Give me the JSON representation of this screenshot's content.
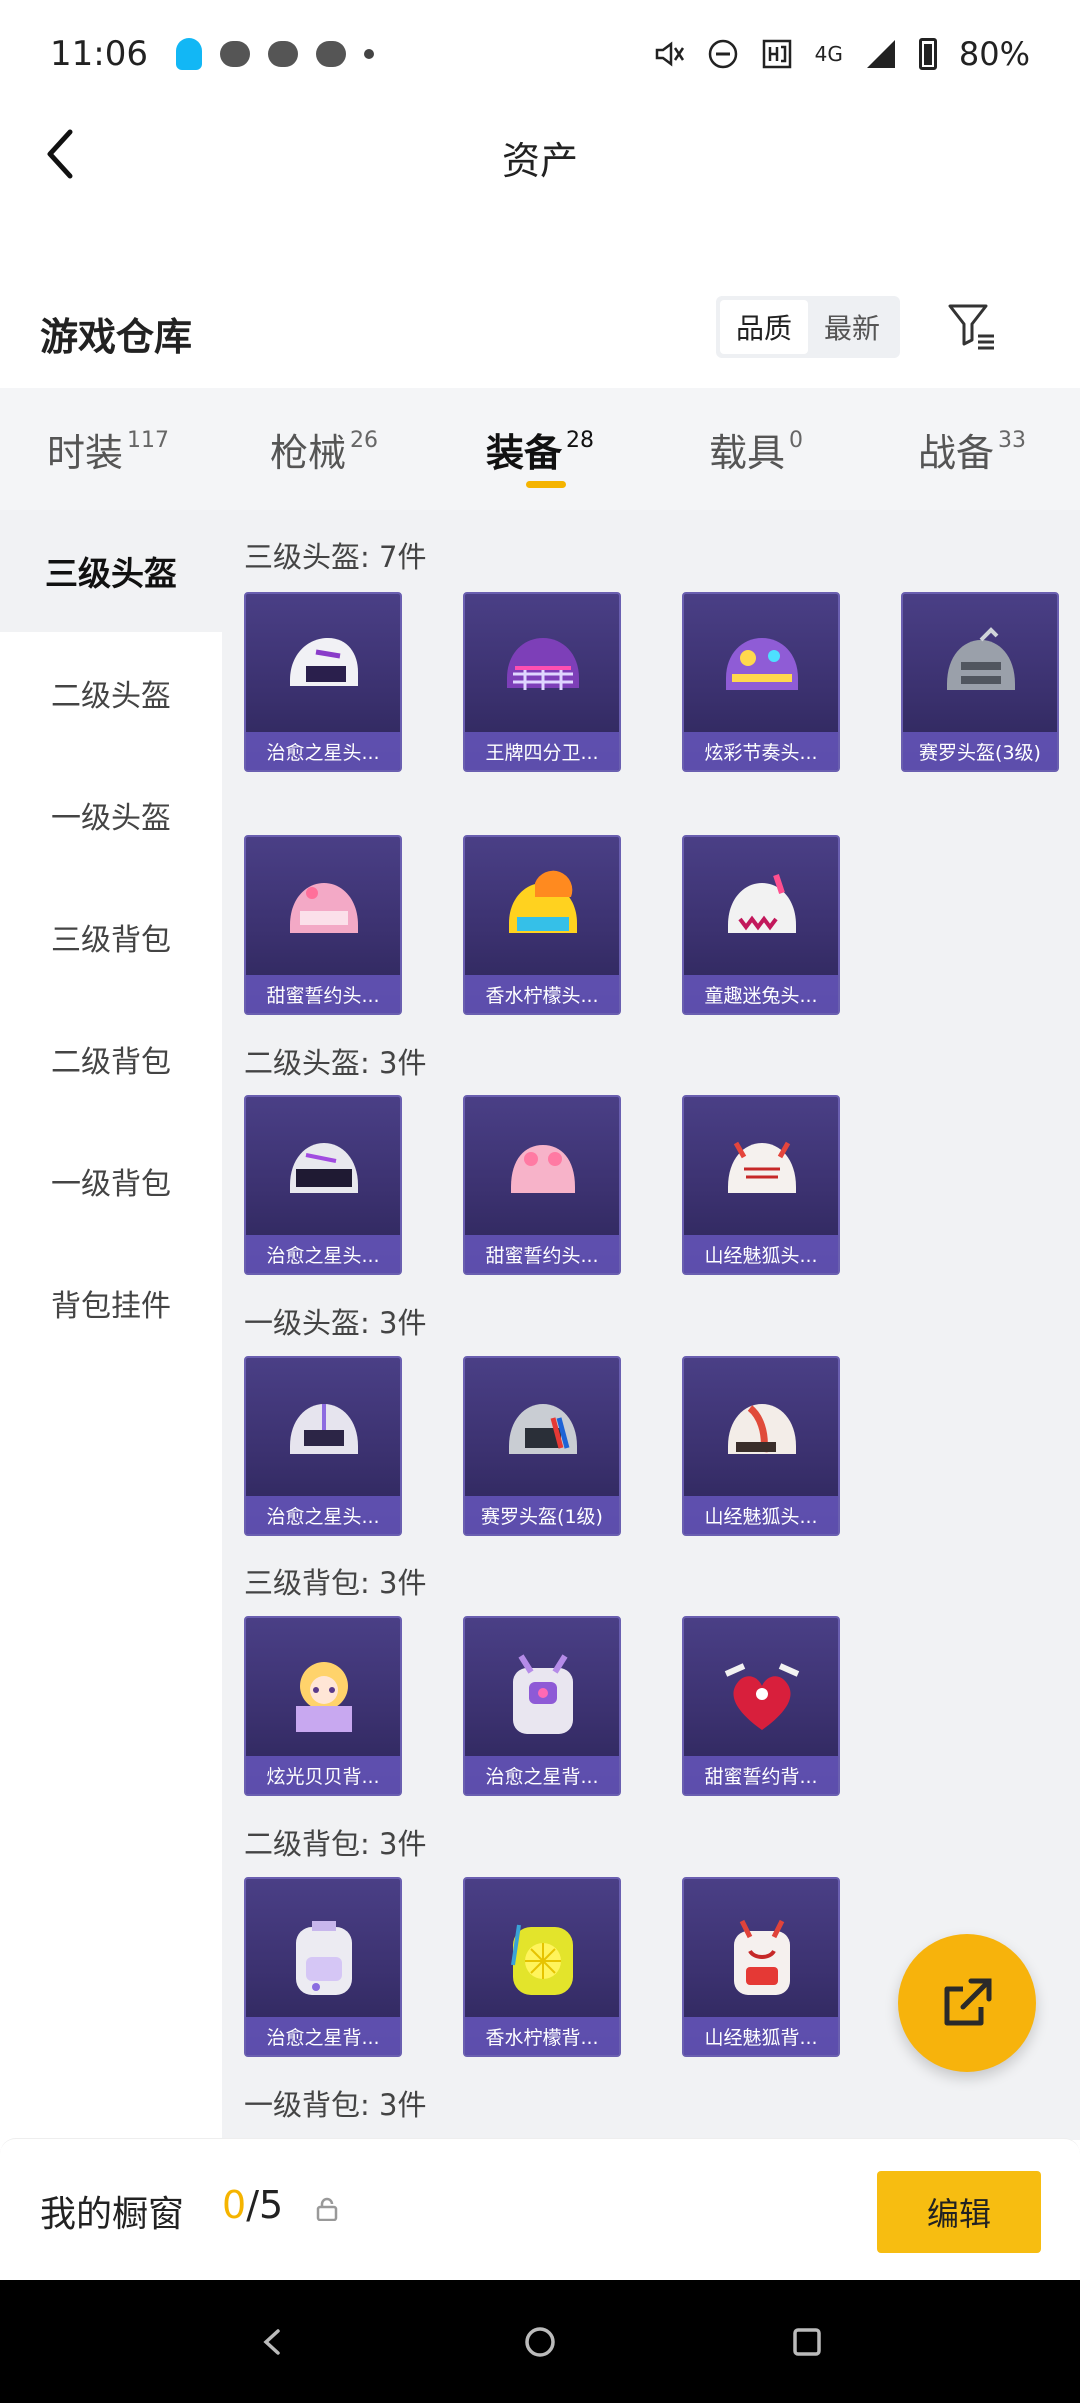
{
  "status_bar": {
    "time": "11:06",
    "network": "4G",
    "battery": "80%"
  },
  "header": {
    "title": "资产"
  },
  "warehouse": {
    "title": "游戏仓库",
    "sort_options": [
      "品质",
      "最新"
    ],
    "active_sort": "品质"
  },
  "tabs": [
    {
      "label": "时装",
      "count": "117"
    },
    {
      "label": "枪械",
      "count": "26"
    },
    {
      "label": "装备",
      "count": "28"
    },
    {
      "label": "载具",
      "count": "0"
    },
    {
      "label": "战备",
      "count": "33"
    }
  ],
  "active_tab": "装备",
  "sidebar": {
    "items": [
      "三级头盔",
      "二级头盔",
      "一级头盔",
      "三级背包",
      "二级背包",
      "一级背包",
      "背包挂件"
    ],
    "active": "三级头盔"
  },
  "sections": [
    {
      "title": "三级头盔: 7件",
      "items": [
        "治愈之星头...",
        "王牌四分卫...",
        "炫彩节奏头...",
        "赛罗头盔(3级)",
        "甜蜜誓约头...",
        "香水柠檬头...",
        "童趣迷兔头..."
      ]
    },
    {
      "title": "二级头盔: 3件",
      "items": [
        "治愈之星头...",
        "甜蜜誓约头...",
        "山经魅狐头..."
      ]
    },
    {
      "title": "一级头盔: 3件",
      "items": [
        "治愈之星头...",
        "赛罗头盔(1级)",
        "山经魅狐头..."
      ]
    },
    {
      "title": "三级背包: 3件",
      "items": [
        "炫光贝贝背...",
        "治愈之星背...",
        "甜蜜誓约背..."
      ]
    },
    {
      "title": "二级背包: 3件",
      "items": [
        "治愈之星背...",
        "香水柠檬背...",
        "山经魅狐背..."
      ]
    },
    {
      "title": "一级背包: 3件",
      "items": []
    }
  ],
  "bottom_bar": {
    "label": "我的橱窗",
    "current": "0",
    "total": "/5",
    "edit_label": "编辑"
  },
  "colors": {
    "accent": "#f7bd11",
    "card_bg": "#3b316f",
    "card_label_bg": "#6e5cc8"
  }
}
